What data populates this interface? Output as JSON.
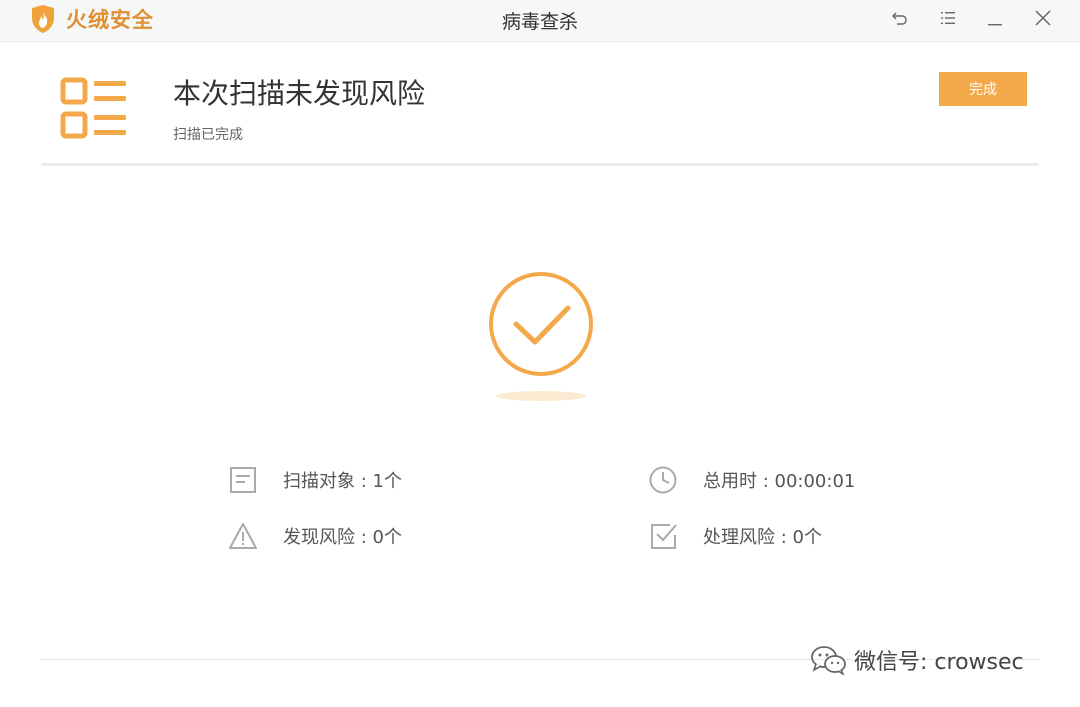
{
  "titlebar": {
    "app_name": "火绒安全",
    "window_title": "病毒查杀",
    "buttons": [
      {
        "name": "back-icon"
      },
      {
        "name": "menu-icon"
      },
      {
        "name": "minimize-icon"
      },
      {
        "name": "close-icon"
      }
    ]
  },
  "header": {
    "title": "本次扫描未发现风险",
    "subtitle": "扫描已完成",
    "done_label": "完成",
    "icon": "checklist-icon"
  },
  "result": {
    "icon": "check-circle-icon"
  },
  "stats": [
    {
      "icon": "document-icon",
      "label": "扫描对象 : 1个"
    },
    {
      "icon": "clock-icon",
      "label": "总用时 : 00:00:01"
    },
    {
      "icon": "warning-icon",
      "label": "发现风险 : 0个"
    },
    {
      "icon": "checkbox-icon",
      "label": "处理风险 : 0个"
    }
  ],
  "watermark": {
    "text": "微信号: crowsec",
    "icon": "wechat-icon"
  },
  "colors": {
    "accent": "#f3a94a",
    "brand": "#e08f33"
  }
}
